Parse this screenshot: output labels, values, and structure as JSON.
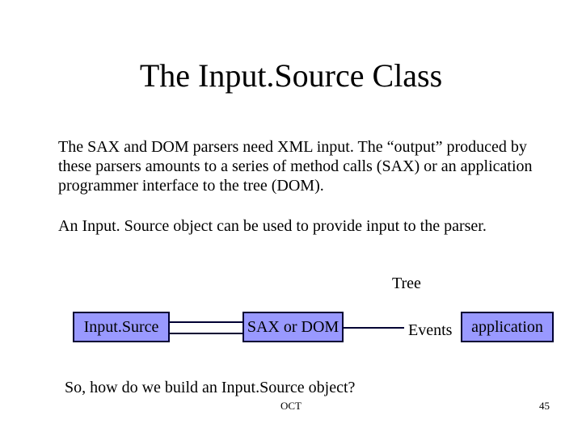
{
  "title": "The Input.Source Class",
  "paragraph1": "The SAX and DOM parsers need XML input. The “output” produced by these parsers amounts to a series of method calls (SAX) or an application programmer interface to the tree (DOM).",
  "paragraph2": "An Input. Source object can be used to provide input to the parser.",
  "paragraph3": "So, how do we build an Input.Source object?",
  "boxes": {
    "input": "Input.Surce",
    "parser": "SAX or DOM",
    "application": "application"
  },
  "labels": {
    "tree": "Tree",
    "events": "Events"
  },
  "footer": {
    "center": "OCT",
    "pageNumber": "45"
  }
}
